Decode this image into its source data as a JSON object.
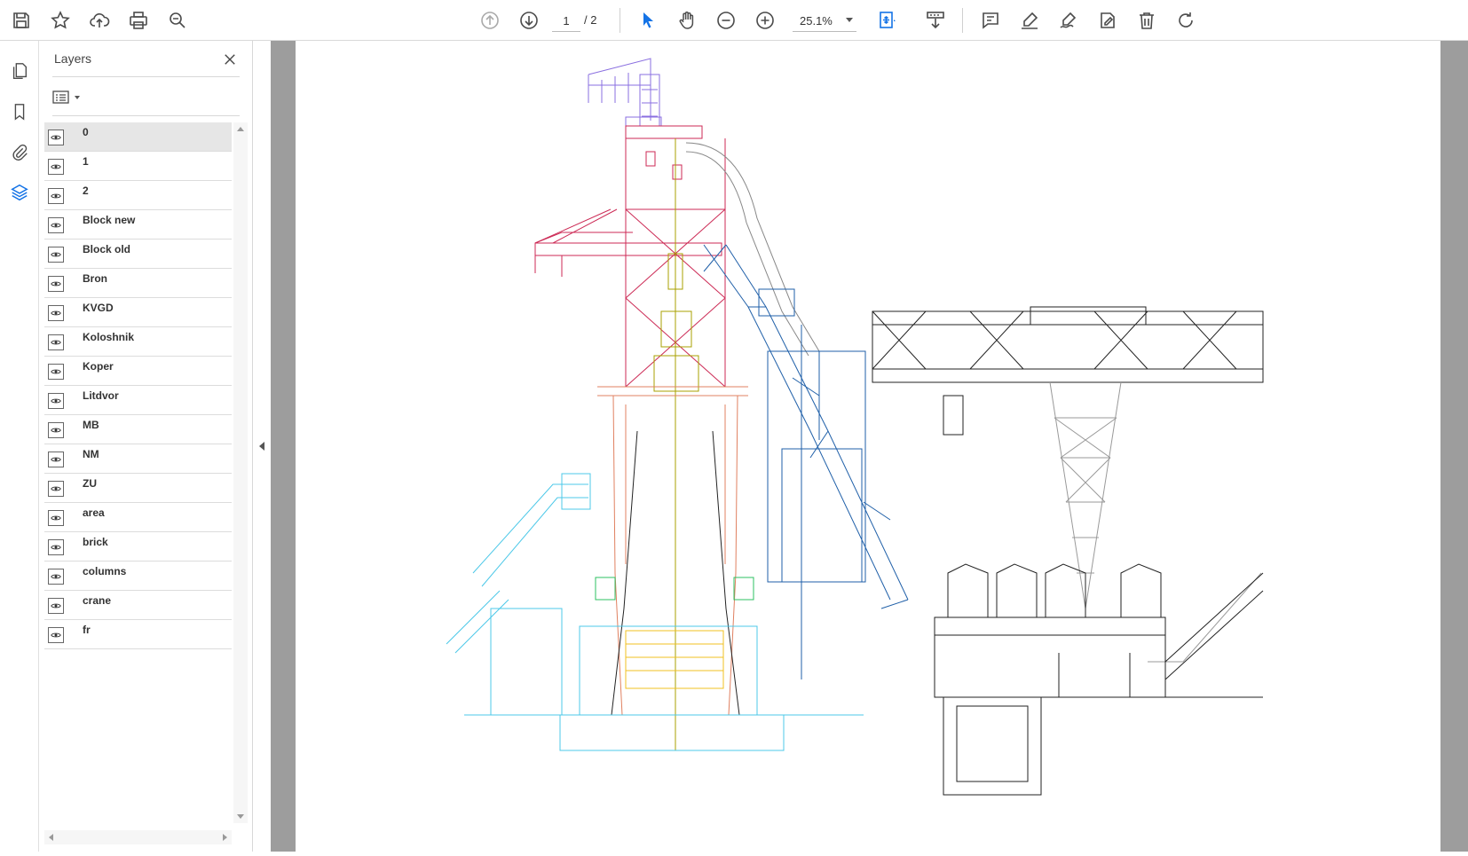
{
  "toolbar": {
    "page_current": "1",
    "page_total": "/ 2",
    "zoom": "25.1%"
  },
  "panel": {
    "title": "Layers"
  },
  "layers": [
    {
      "name": "0"
    },
    {
      "name": "1"
    },
    {
      "name": "2"
    },
    {
      "name": "Block new"
    },
    {
      "name": "Block old"
    },
    {
      "name": "Bron"
    },
    {
      "name": "KVGD"
    },
    {
      "name": "Koloshnik"
    },
    {
      "name": "Koper"
    },
    {
      "name": "Litdvor"
    },
    {
      "name": "MB"
    },
    {
      "name": "NM"
    },
    {
      "name": "ZU"
    },
    {
      "name": "area"
    },
    {
      "name": "brick"
    },
    {
      "name": "columns"
    },
    {
      "name": "crane"
    },
    {
      "name": "fr"
    }
  ],
  "colors": {
    "accent": "#1473e6",
    "icon": "#4b4b4b",
    "viewer_bg": "#9d9d9d"
  }
}
